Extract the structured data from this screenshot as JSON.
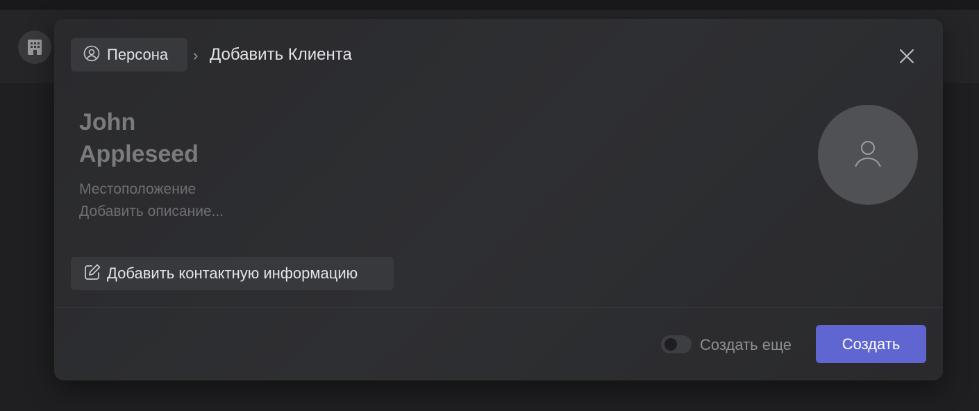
{
  "breadcrumb": {
    "type_label": "Персона",
    "separator": "›",
    "title": "Добавить Клиента"
  },
  "form": {
    "name_line1": "John",
    "name_line2": "Appleseed",
    "location_placeholder": "Местоположение",
    "description_placeholder": "Добавить описание..."
  },
  "actions": {
    "add_contact_label": "Добавить контактную информацию",
    "create_more_label": "Создать еще",
    "create_more_enabled": false,
    "create_label": "Создать"
  },
  "colors": {
    "accent": "#6066d1",
    "modal_bg": "#2c2d30",
    "chip_bg": "#38393c"
  },
  "icons": {
    "type": "person-circle-icon",
    "close": "close-icon",
    "avatar": "user-icon",
    "contact": "edit-icon",
    "background": "building-icon"
  }
}
